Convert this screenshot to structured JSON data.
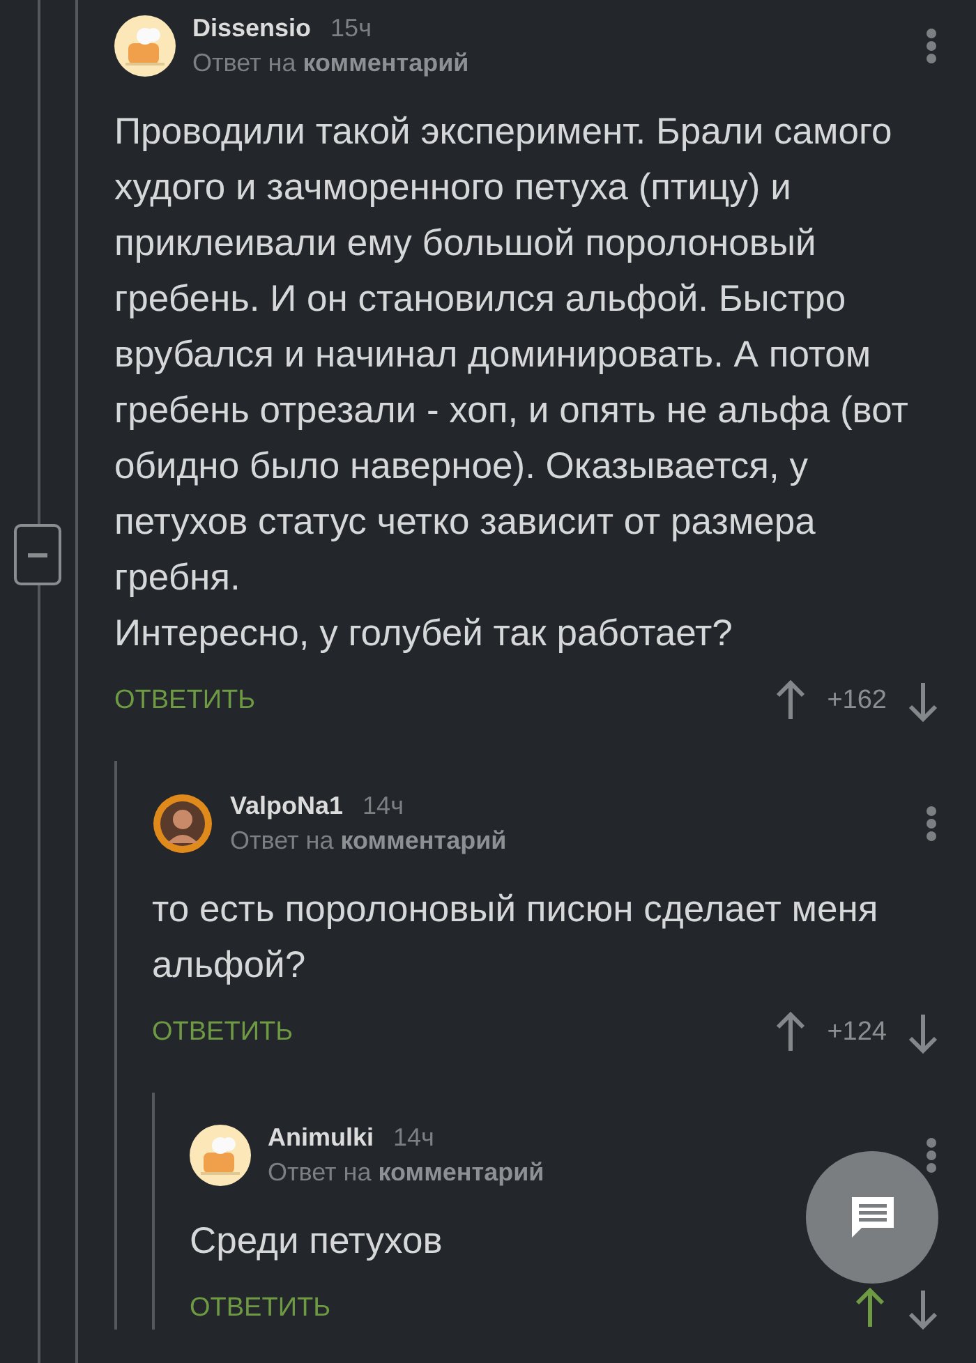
{
  "comments": [
    {
      "author": "Dissensio",
      "time": "15ч",
      "reply_to": "Ответ на **комментарий**",
      "avatar": {
        "kind": "cartoon"
      },
      "text": "Проводили такой эксперимент. Брали самого худого и зачморенного петуха (птицу) и приклеивали ему большой поролоновый гребень. И он становился альфой. Быстро врубался и начинал доминировать. А потом гребень отрезали - хоп, и опять не альфа (вот обидно было наверное). Оказывается, у петухов статус четко зависит от размера гребня.\nИнтересно, у голубей так работает?",
      "reply": "ОТВЕТИТЬ",
      "score": "+162",
      "upvoted": false,
      "children": [
        {
          "author": "ValpoNa1",
          "time": "14ч",
          "reply_to": "Ответ на **комментарий**",
          "avatar": {
            "kind": "photo"
          },
          "text": "то есть поролоновый писюн сделает меня альфой?",
          "reply": "ОТВЕТИТЬ",
          "score": "+124",
          "upvoted": false,
          "children": [
            {
              "author": "Animulki",
              "time": "14ч",
              "reply_to": "Ответ на **комментарий**",
              "avatar": {
                "kind": "cartoon"
              },
              "text": "Среди петухов",
              "reply": "ОТВЕТИТЬ",
              "upvoted": true
            }
          ]
        }
      ]
    }
  ]
}
